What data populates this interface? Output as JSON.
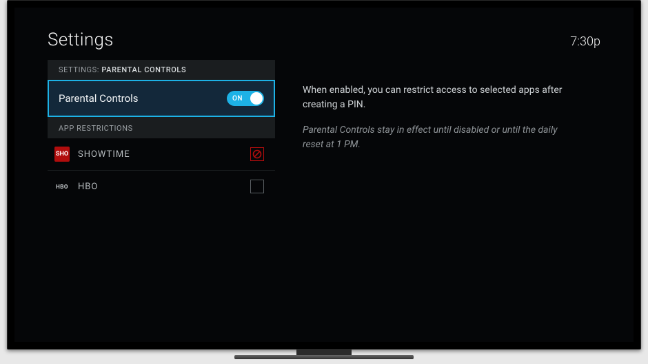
{
  "header": {
    "title": "Settings",
    "clock": "7:30p"
  },
  "breadcrumb": {
    "prefix": "SETTINGS:",
    "current": "PARENTAL CONTROLS"
  },
  "toggle": {
    "label": "Parental Controls",
    "state_text": "ON"
  },
  "app_restrictions": {
    "label": "APP RESTRICTIONS",
    "items": [
      {
        "icon_text": "SHO",
        "name": "SHOWTIME",
        "restricted": true
      },
      {
        "icon_text": "HBO",
        "name": "HBO",
        "restricted": false
      }
    ]
  },
  "description": {
    "line1": "When enabled, you can restrict access to selected apps after creating a PIN.",
    "line2": "Parental Controls stay in effect until disabled or until the daily reset at 1 PM."
  }
}
